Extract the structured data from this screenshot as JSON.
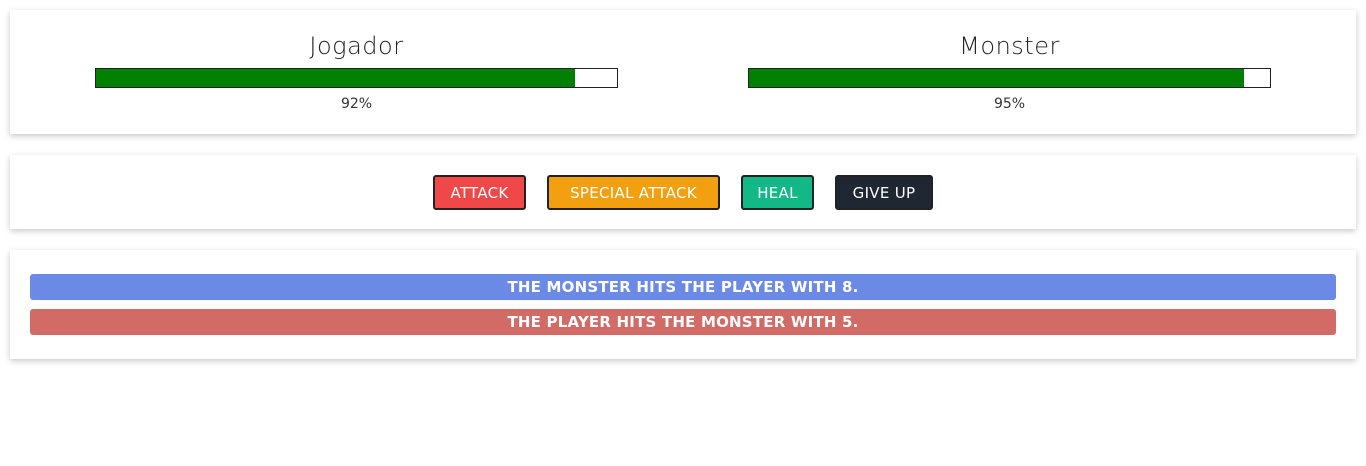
{
  "player": {
    "name": "Jogador",
    "health_percent": 92,
    "health_label": "92%"
  },
  "monster": {
    "name": "Monster",
    "health_percent": 95,
    "health_label": "95%"
  },
  "colors": {
    "health_fill": "#008000",
    "attack": "#f04848",
    "special_attack": "#f3a010",
    "heal": "#12b886",
    "give_up": "#1f2733",
    "log_monster": "#6b8ae6",
    "log_player": "#d26a66"
  },
  "controls": {
    "attack_label": "ATTACK",
    "special_attack_label": "SPECIAL ATTACK",
    "heal_label": "HEAL",
    "give_up_label": "GIVE UP"
  },
  "log": [
    {
      "text": "THE MONSTER HITS THE PLAYER WITH 8.",
      "actor": "monster"
    },
    {
      "text": "THE PLAYER HITS THE MONSTER WITH 5.",
      "actor": "player"
    }
  ]
}
